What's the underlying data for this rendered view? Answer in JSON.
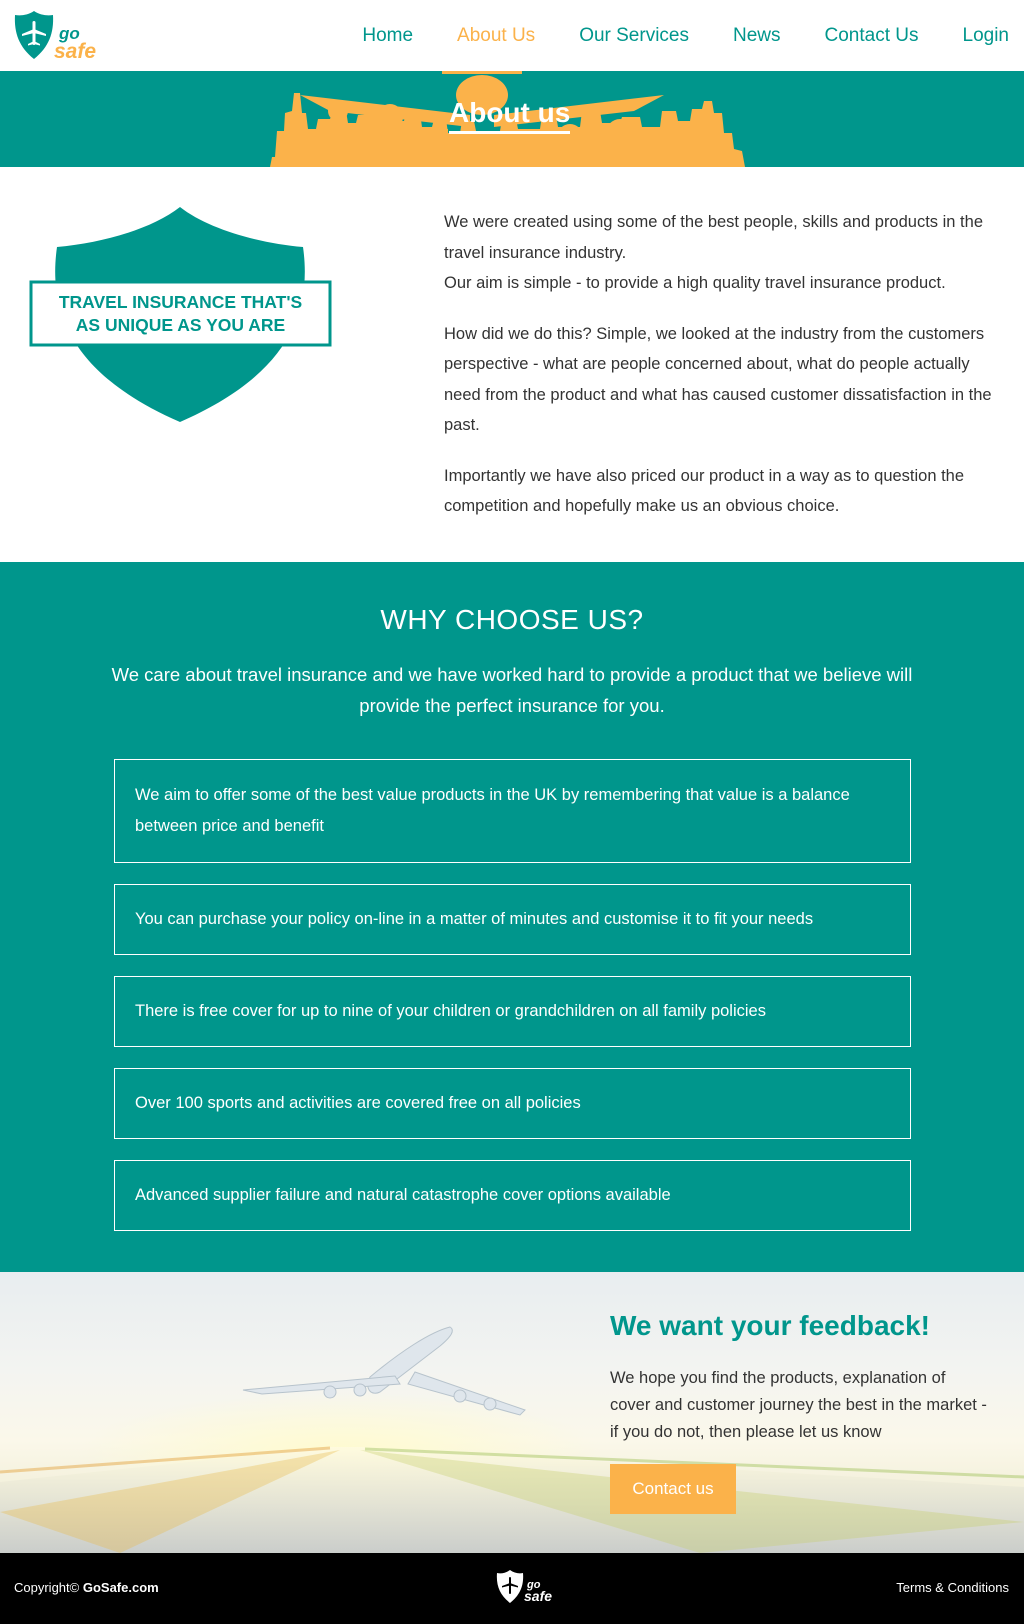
{
  "header": {
    "logo_alt": "GoSafe",
    "nav": [
      {
        "label": "Home",
        "active": false
      },
      {
        "label": "About Us",
        "active": true
      },
      {
        "label": "Our Services",
        "active": false
      },
      {
        "label": "News",
        "active": false
      },
      {
        "label": "Contact Us",
        "active": false
      },
      {
        "label": "Login",
        "active": false
      }
    ]
  },
  "hero": {
    "title": "About us"
  },
  "about": {
    "badge_line1": "TRAVEL INSURANCE THAT'S",
    "badge_line2": "AS UNIQUE AS YOU ARE",
    "p1a": "We were created using some of the best people, skills and products in the travel insurance industry.",
    "p1b": "Our aim is simple - to provide a high quality travel insurance product.",
    "p2": "How did we do this? Simple, we looked at the industry from the customers perspective - what are people concerned about, what do people actually need from the product and what has caused customer dissatisfaction in the past.",
    "p3": "Importantly we have also priced our product in a way as to question the competition and hopefully make us an obvious choice."
  },
  "why": {
    "title": "WHY CHOOSE US?",
    "subtitle": "We care about travel insurance and we have worked hard to provide a product that we believe will provide the perfect insurance for you.",
    "items": [
      "We aim to offer some of the best value products in the UK by remembering that value is a balance between price and benefit",
      "You can purchase your policy on-line in a matter of minutes and customise it to fit your needs",
      "There is free cover for up to nine of your children or grandchildren on all family policies",
      "Over 100 sports and activities are covered free on all policies",
      "Advanced supplier failure and natural catastrophe cover options available"
    ]
  },
  "feedback": {
    "title": "We want your feedback!",
    "text": "We hope you find the products, explanation of cover and customer journey the best in the market - if you do not, then please let us know",
    "button": "Contact us"
  },
  "footer": {
    "copyright_prefix": "Copyright©",
    "copyright_brand": "GoSafe.com",
    "terms": "Terms & Conditions"
  },
  "colors": {
    "brand_teal": "#00968c",
    "accent_orange": "#fbb24a",
    "footer_black": "#000000"
  },
  "icons": [
    "gosafe-logo-icon",
    "plane-icon",
    "shield-badge-icon"
  ]
}
